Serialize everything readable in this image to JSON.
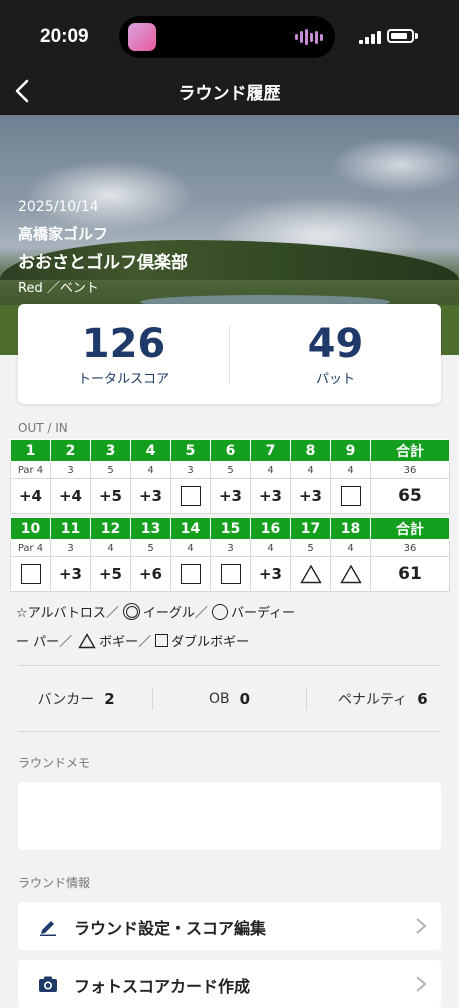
{
  "status_bar": {
    "time": "20:09"
  },
  "nav": {
    "title": "ラウンド履歴"
  },
  "hero": {
    "date": "2025/10/14",
    "organizer": "高橋家ゴルフ",
    "course": "おおさとゴルフ倶楽部",
    "tee": "Red ／ベント"
  },
  "summary": {
    "total_score": "126",
    "total_score_label": "トータルスコア",
    "putts": "49",
    "putts_label": "パット"
  },
  "scorecard": {
    "section_label": "OUT / IN",
    "total_label": "合計",
    "out": {
      "holes": [
        "1",
        "2",
        "3",
        "4",
        "5",
        "6",
        "7",
        "8",
        "9"
      ],
      "pars": [
        "Par 4",
        "3",
        "5",
        "4",
        "3",
        "5",
        "4",
        "4",
        "4"
      ],
      "par_total": "36",
      "scores": [
        "+4",
        "+4",
        "+5",
        "+3",
        "double-bogey",
        "+3",
        "+3",
        "+3",
        "double-bogey"
      ],
      "score_total": "65"
    },
    "in": {
      "holes": [
        "10",
        "11",
        "12",
        "13",
        "14",
        "15",
        "16",
        "17",
        "18"
      ],
      "pars": [
        "Par 4",
        "3",
        "4",
        "5",
        "4",
        "3",
        "4",
        "5",
        "4"
      ],
      "par_total": "36",
      "scores": [
        "double-bogey",
        "+3",
        "+5",
        "+6",
        "double-bogey",
        "double-bogey",
        "+3",
        "bogey",
        "bogey"
      ],
      "score_total": "61"
    }
  },
  "legend": {
    "albatross": "☆アルバトロス／",
    "eagle": "イーグル／",
    "birdie": "バーディー",
    "par": "ー パー／",
    "bogey": "ボギー／",
    "double_bogey": "ダブルボギー"
  },
  "stats": {
    "bunker_label": "バンカー",
    "bunker": "2",
    "ob_label": "OB",
    "ob": "0",
    "penalty_label": "ペナルティ",
    "penalty": "6"
  },
  "memo": {
    "label": "ラウンドメモ"
  },
  "round_info": {
    "label": "ラウンド情報",
    "edit_label": "ラウンド設定・スコア編集",
    "photo_label": "フォトスコアカード作成"
  },
  "colors": {
    "accent_green": "#14a01e",
    "score_navy": "#1f3a68"
  }
}
